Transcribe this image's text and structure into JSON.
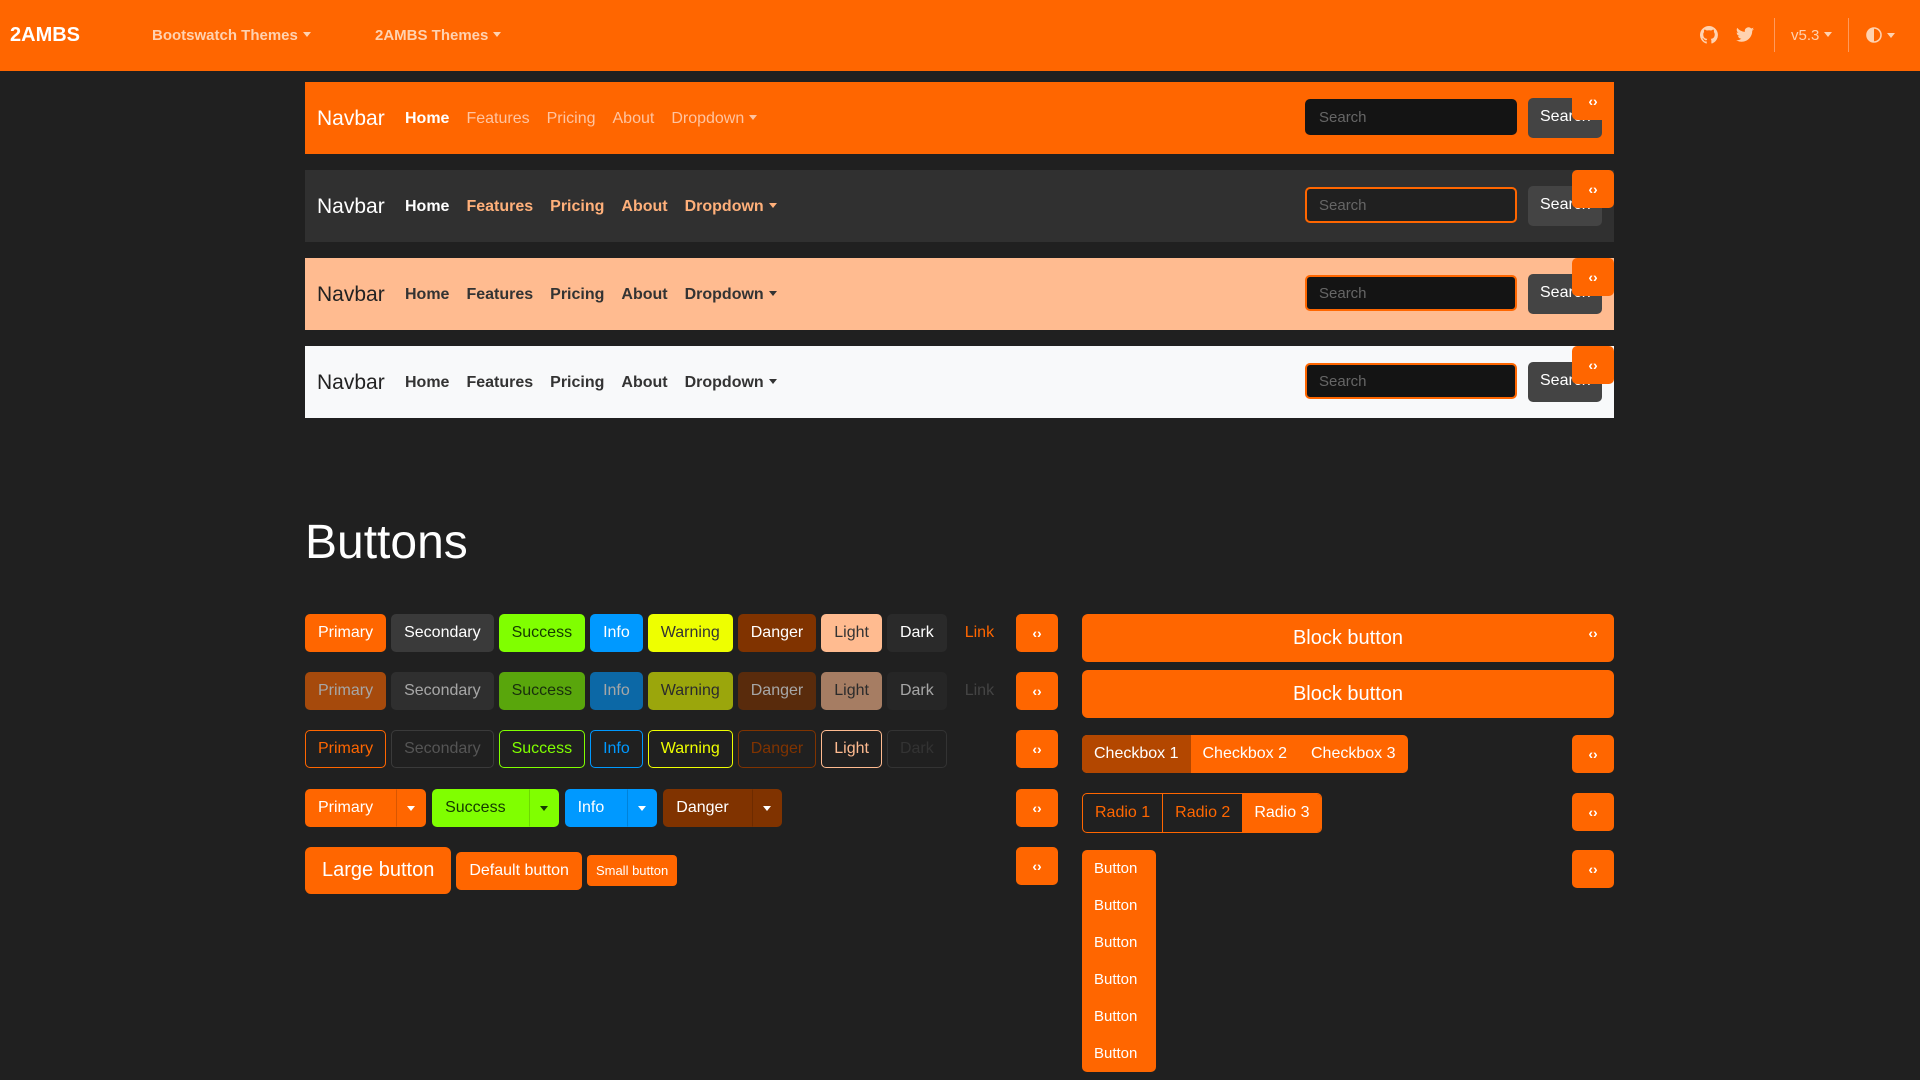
{
  "topbar": {
    "brand": "2AMBS",
    "menus": [
      "Bootswatch Themes",
      "2AMBS Themes"
    ],
    "version": "v5.3",
    "icons": [
      "github-icon",
      "twitter-icon",
      "theme-toggle-icon"
    ]
  },
  "navbars": [
    {
      "brand": "Navbar",
      "links": [
        "Home",
        "Features",
        "Pricing",
        "About",
        "Dropdown"
      ],
      "search_placeholder": "Search",
      "search_button": "Search"
    },
    {
      "brand": "Navbar",
      "links": [
        "Home",
        "Features",
        "Pricing",
        "About",
        "Dropdown"
      ],
      "search_placeholder": "Search",
      "search_button": "Search"
    },
    {
      "brand": "Navbar",
      "links": [
        "Home",
        "Features",
        "Pricing",
        "About",
        "Dropdown"
      ],
      "search_placeholder": "Search",
      "search_button": "Search"
    },
    {
      "brand": "Navbar",
      "links": [
        "Home",
        "Features",
        "Pricing",
        "About",
        "Dropdown"
      ],
      "search_placeholder": "Search",
      "search_button": "Search"
    }
  ],
  "code_icon": "‹›",
  "heading": "Buttons",
  "buttons": {
    "solid": [
      "Primary",
      "Secondary",
      "Success",
      "Info",
      "Warning",
      "Danger",
      "Light",
      "Dark",
      "Link"
    ],
    "disabled": [
      "Primary",
      "Secondary",
      "Success",
      "Info",
      "Warning",
      "Danger",
      "Light",
      "Dark",
      "Link"
    ],
    "outline": [
      "Primary",
      "Secondary",
      "Success",
      "Info",
      "Warning",
      "Danger",
      "Light",
      "Dark"
    ],
    "split": [
      "Primary",
      "Success",
      "Info",
      "Danger"
    ],
    "sizes": [
      "Large button",
      "Default button",
      "Small button"
    ],
    "block": [
      "Block button",
      "Block button"
    ],
    "checkboxes": [
      "Checkbox 1",
      "Checkbox 2",
      "Checkbox 3"
    ],
    "radios": [
      "Radio 1",
      "Radio 2",
      "Radio 3"
    ],
    "vertical": [
      "Button",
      "Button",
      "Button",
      "Button",
      "Button",
      "Button"
    ]
  },
  "colors": {
    "primary": "#ff6600",
    "background": "#202020"
  }
}
